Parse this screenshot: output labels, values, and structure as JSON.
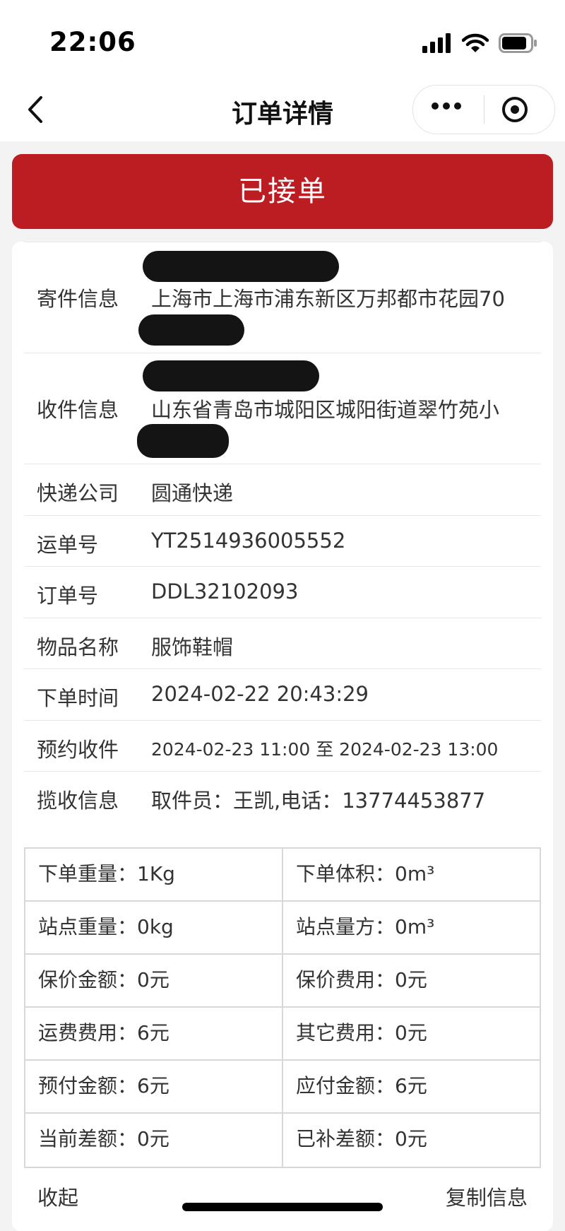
{
  "status_bar": {
    "time": "22:06"
  },
  "nav": {
    "title": "订单详情"
  },
  "banner": {
    "status": "已接单",
    "color": "#bb1d22"
  },
  "details": {
    "sender_label": "寄件信息",
    "sender_address": "上海市上海市浦东新区万邦都市花园70",
    "receiver_label": "收件信息",
    "receiver_address": "山东省青岛市城阳区城阳街道翠竹苑小",
    "courier_label": "快递公司",
    "courier_value": "圆通快递",
    "waybill_label": "运单号",
    "waybill_value": "YT2514936005552",
    "order_label": "订单号",
    "order_value": "DDL32102093",
    "item_label": "物品名称",
    "item_value": "服饰鞋帽",
    "order_time_label": "下单时间",
    "order_time_value": "2024-02-22 20:43:29",
    "pickup_window_label": "预约收件",
    "pickup_window_value": "2024-02-23 11:00 至 2024-02-23 13:00",
    "pickup_info_label": "揽收信息",
    "pickup_info_value": "取件员：王凯,电话：13774453877"
  },
  "fees": [
    [
      "下单重量：1Kg",
      "下单体积：0m³"
    ],
    [
      "站点重量：0kg",
      "站点量方：0m³"
    ],
    [
      "保价金额：0元",
      "保价费用：0元"
    ],
    [
      "运费费用：6元",
      "其它费用：0元"
    ],
    [
      "预付金额：6元",
      "应付金额：6元"
    ],
    [
      "当前差额：0元",
      "已补差额：0元"
    ]
  ],
  "footer": {
    "collapse": "收起",
    "copy": "复制信息"
  }
}
